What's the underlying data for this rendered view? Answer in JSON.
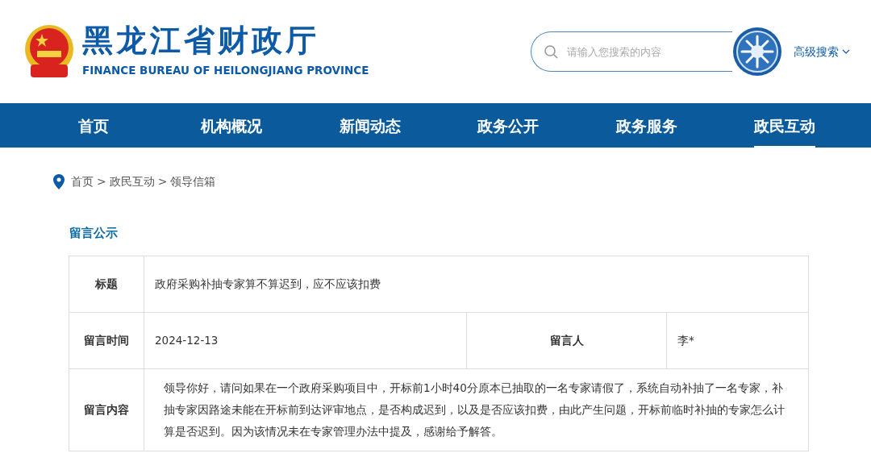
{
  "header": {
    "title": "黑龙江省财政厅",
    "subtitle": "FINANCE BUREAU OF HEILONGJIANG PROVINCE"
  },
  "search": {
    "placeholder": "请输入您搜索的内容",
    "advanced": "高级搜索"
  },
  "nav": [
    {
      "label": "首页",
      "selected": false
    },
    {
      "label": "机构概况",
      "selected": false
    },
    {
      "label": "新闻动态",
      "selected": false
    },
    {
      "label": "政务公开",
      "selected": false
    },
    {
      "label": "政务服务",
      "selected": false
    },
    {
      "label": "政民互动",
      "selected": true
    }
  ],
  "breadcrumb": [
    "首页",
    "政民互动",
    "领导信箱"
  ],
  "breadcrumb_separator": ">",
  "section_title": "留言公示",
  "message": {
    "title_label": "标题",
    "title": "政府采购补抽专家算不算迟到，应不应该扣费",
    "time_label": "留言时间",
    "time": "2024-12-13",
    "author_label": "留言人",
    "author": "李*",
    "content_label": "留言内容",
    "content": "领导你好，请问如果在一个政府采购项目中，开标前1小时40分原本已抽取的一名专家请假了，系统自动补抽了一名专家，补抽专家因路途未能在开标前到达评审地点，是否构成迟到，以及是否应该扣费，由此产生问题，开标前临时补抽的专家怎么计算是否迟到。因为该情况未在专家管理办法中提及，感谢给予解答。"
  }
}
